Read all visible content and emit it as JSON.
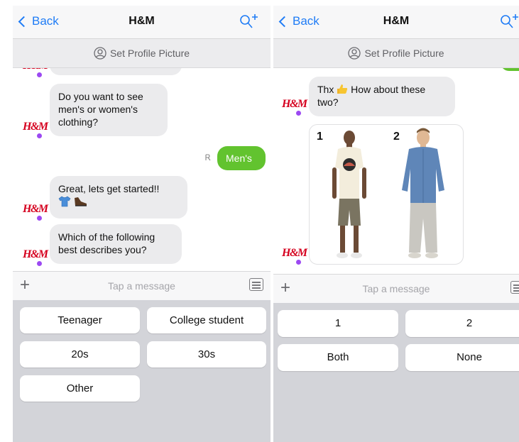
{
  "left": {
    "nav": {
      "back_label": "Back",
      "title": "H&M"
    },
    "profile_label": "Set Profile Picture",
    "avatar_text": "H&M",
    "messages": [
      {
        "from": "bot",
        "text": "Do you want to see men's or women's clothing?"
      },
      {
        "from": "user",
        "text": "Men's"
      },
      {
        "from": "bot",
        "text": "Great, lets get started!!"
      },
      {
        "from": "bot",
        "text": "Which of the following best describes you?"
      }
    ],
    "composer_placeholder": "Tap a message",
    "quick_replies": [
      "Teenager",
      "College student",
      "20s",
      "30s",
      "Other"
    ]
  },
  "right": {
    "nav": {
      "back_label": "Back",
      "title": "H&M"
    },
    "profile_label": "Set Profile Picture",
    "avatar_text": "H&M",
    "messages": [
      {
        "from": "bot",
        "text_before": "Thx",
        "text_after": "How about these two?"
      }
    ],
    "photo_labels": [
      "1",
      "2"
    ],
    "composer_placeholder": "Tap a message",
    "quick_replies": [
      "1",
      "2",
      "Both",
      "None"
    ]
  },
  "colors": {
    "accent_blue": "#1f7cf6",
    "user_bubble": "#62c32f",
    "bot_bubble": "#ebebed",
    "hm_red": "#d5001e",
    "presence_dot": "#9c49f2",
    "quick_reply_tray": "#d3d4d9"
  },
  "icons": [
    "back-chevron-icon",
    "add-people-icon",
    "user-circle-icon",
    "plus-icon",
    "menu-icon",
    "thumbs-up-emoji",
    "tshirt-emoji",
    "shoe-emoji",
    "delivered-icon"
  ]
}
